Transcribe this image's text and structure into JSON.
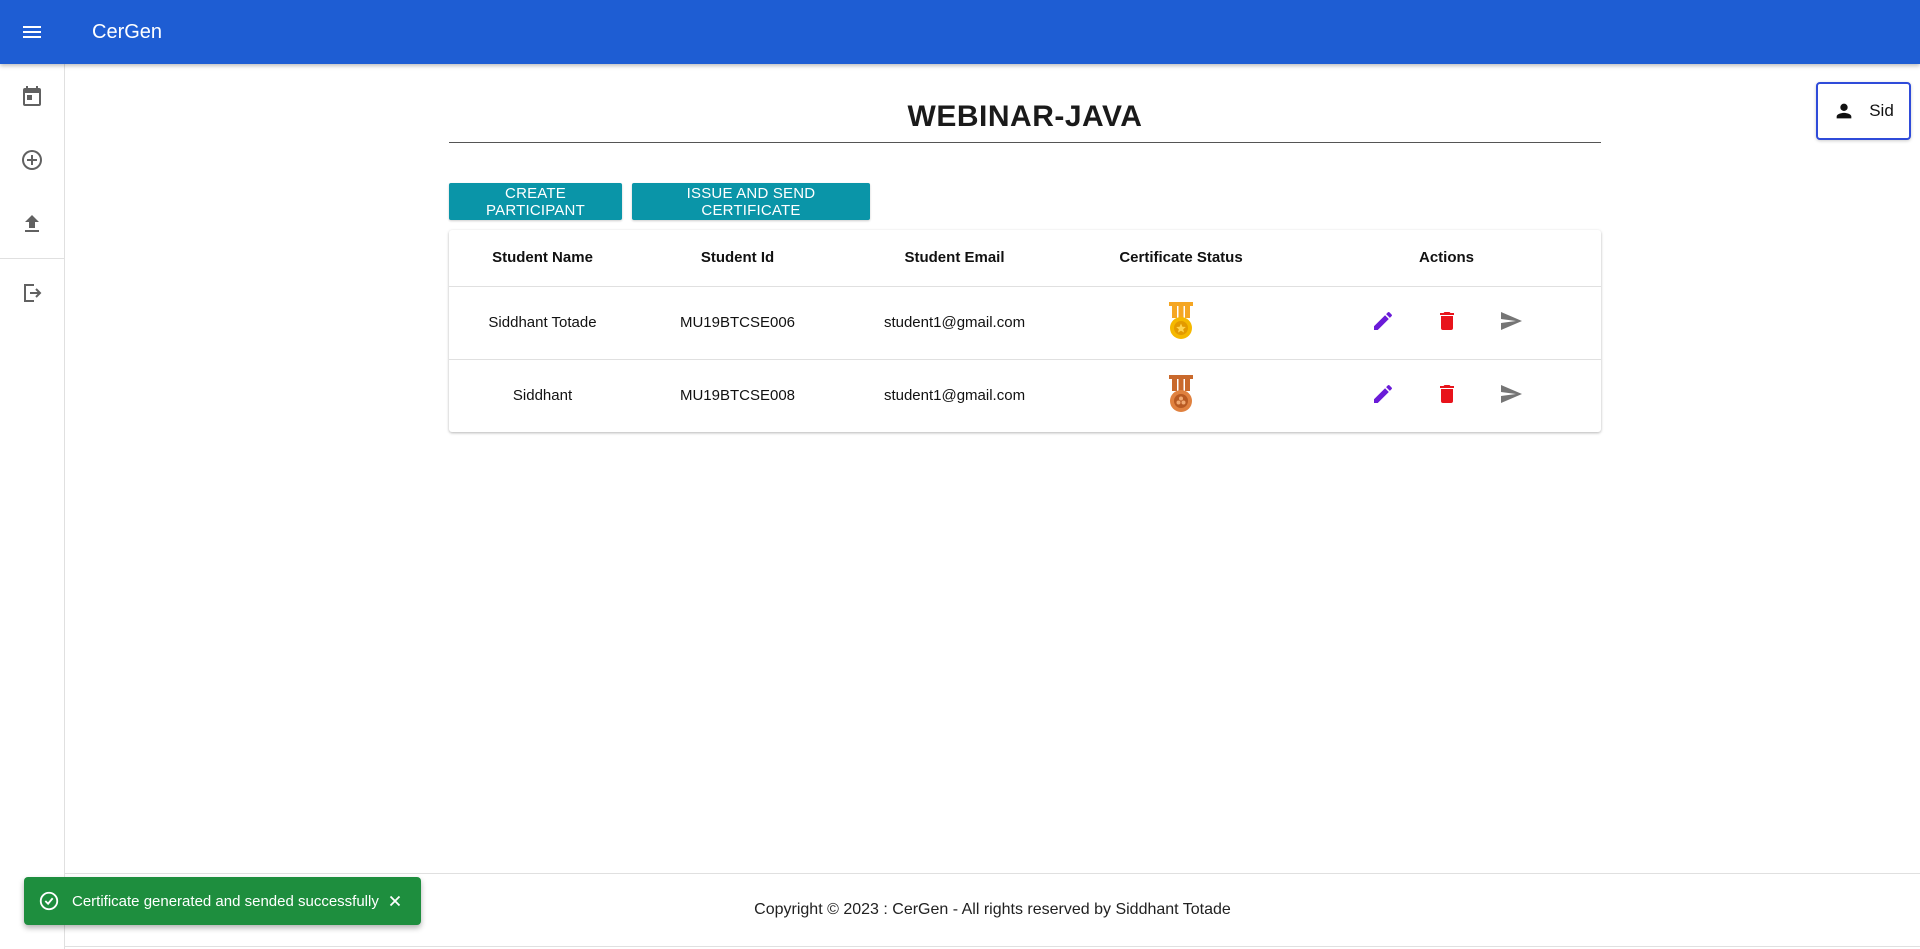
{
  "appbar": {
    "title": "CerGen",
    "menu_icon": "menu-icon",
    "color": "#1e5dd3"
  },
  "sidebar": {
    "items": [
      {
        "icon": "calendar-icon"
      },
      {
        "icon": "add-circle-icon"
      },
      {
        "icon": "upload-icon"
      },
      {
        "icon": "logout-icon"
      }
    ]
  },
  "user": {
    "name": "Sid",
    "icon": "person-icon"
  },
  "page": {
    "title": "WEBINAR-JAVA"
  },
  "buttons": {
    "create": "CREATE PARTICIPANT",
    "issue": "ISSUE AND SEND CERTIFICATE",
    "color": "#0a95a8"
  },
  "table": {
    "headers": [
      "Student Name",
      "Student Id",
      "Student Email",
      "Certificate Status",
      "Actions"
    ],
    "rows": [
      {
        "name": "Siddhant Totade",
        "id": "MU19BTCSE006",
        "email": "student1@gmail.com",
        "status_icon": "gold-medal-icon"
      },
      {
        "name": "Siddhant",
        "id": "MU19BTCSE008",
        "email": "student1@gmail.com",
        "status_icon": "bronze-medal-icon"
      }
    ],
    "action_icons": [
      "edit-icon",
      "delete-icon",
      "send-icon"
    ]
  },
  "footer": {
    "text": "Copyright © 2023 : CerGen - All rights reserved by Siddhant Totade"
  },
  "toast": {
    "message": "Certificate generated and sended successfully",
    "color": "#1e8e3e"
  }
}
